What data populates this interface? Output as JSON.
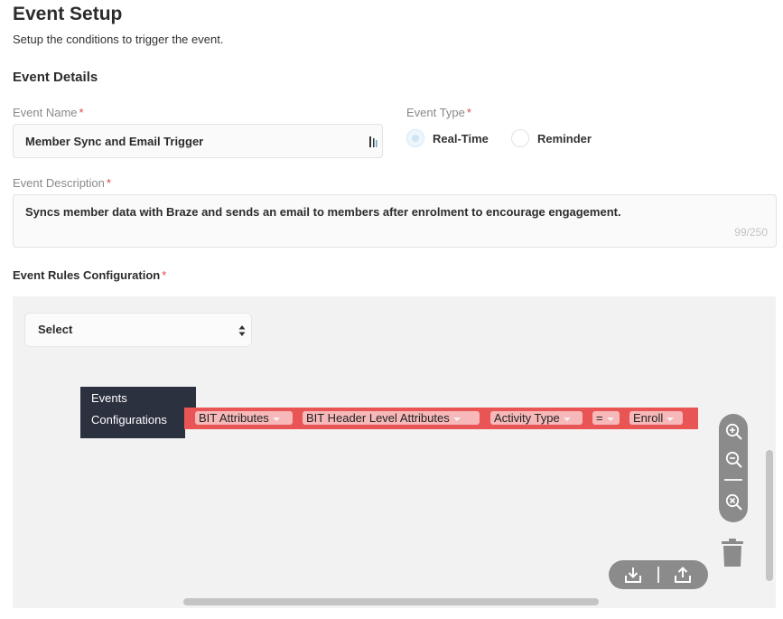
{
  "page": {
    "title": "Event Setup",
    "subtitle": "Setup the conditions to trigger the event."
  },
  "event_details": {
    "heading": "Event Details",
    "name_label": "Event Name",
    "name_value": "Member Sync and Email Trigger",
    "type_label": "Event Type",
    "type_options": [
      "Real-Time",
      "Reminder"
    ],
    "type_selected": "Real-Time",
    "description_label": "Event Description",
    "description_value": "Syncs member data with Braze and sends an email to members after enrolment to encourage engagement.",
    "description_count": "99/250",
    "required_marker": "*"
  },
  "rules": {
    "heading": "Event Rules Configuration",
    "select_value": "Select",
    "category_tab": "Events",
    "category_label": "Configurations",
    "condition_pills": [
      "BIT Attributes",
      "BIT Header Level Attributes",
      "Activity Type",
      "=",
      "Enroll"
    ]
  },
  "colors": {
    "rule_bar": "#e95454",
    "pill_bg": "#f6b8b8",
    "dark_block": "#2c3140",
    "canvas_bg": "#f2f2f2",
    "required": "#e04848"
  },
  "icons": {
    "name_field_icon": "text-cursor-icon",
    "select_arrows": "sort-arrows-icon",
    "zoom_in": "zoom-in-icon",
    "zoom_out": "zoom-out-icon",
    "zoom_reset": "zoom-reset-icon",
    "trash": "trash-icon",
    "download": "download-icon",
    "upload": "upload-icon"
  }
}
